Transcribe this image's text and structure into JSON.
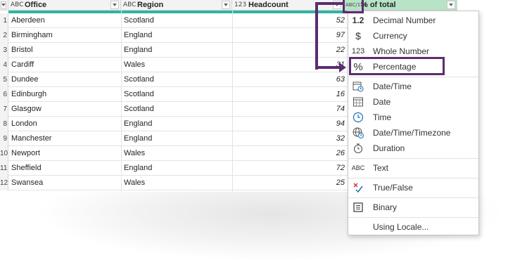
{
  "columns": [
    {
      "type_icon": "ABC",
      "name": "Office"
    },
    {
      "type_icon": "ABC",
      "name": "Region"
    },
    {
      "type_icon": "123",
      "name": "Headcount"
    },
    {
      "type_icon": "ABC/123",
      "name": "% of total"
    }
  ],
  "rows": [
    {
      "idx": "1",
      "office": "Aberdeen",
      "region": "Scotland",
      "headcount": "52"
    },
    {
      "idx": "2",
      "office": "Birmingham",
      "region": "England",
      "headcount": "97"
    },
    {
      "idx": "3",
      "office": "Bristol",
      "region": "England",
      "headcount": "22"
    },
    {
      "idx": "4",
      "office": "Cardiff",
      "region": "Wales",
      "headcount": "31"
    },
    {
      "idx": "5",
      "office": "Dundee",
      "region": "Scotland",
      "headcount": "63"
    },
    {
      "idx": "6",
      "office": "Edinburgh",
      "region": "Scotland",
      "headcount": "16"
    },
    {
      "idx": "7",
      "office": "Glasgow",
      "region": "Scotland",
      "headcount": "74"
    },
    {
      "idx": "8",
      "office": "London",
      "region": "England",
      "headcount": "94"
    },
    {
      "idx": "9",
      "office": "Manchester",
      "region": "England",
      "headcount": "32"
    },
    {
      "idx": "10",
      "office": "Newport",
      "region": "Wales",
      "headcount": "26"
    },
    {
      "idx": "11",
      "office": "Sheffield",
      "region": "England",
      "headcount": "72"
    },
    {
      "idx": "12",
      "office": "Swansea",
      "region": "Wales",
      "headcount": "25"
    }
  ],
  "menu": {
    "items": [
      {
        "icon": "1.2",
        "label": "Decimal Number"
      },
      {
        "icon": "$",
        "label": "Currency"
      },
      {
        "icon": "123",
        "label": "Whole Number"
      },
      {
        "icon": "%",
        "label": "Percentage"
      },
      {
        "icon": "calendar-clock-icon",
        "label": "Date/Time"
      },
      {
        "icon": "calendar-icon",
        "label": "Date"
      },
      {
        "icon": "clock-icon",
        "label": "Time"
      },
      {
        "icon": "globe-clock-icon",
        "label": "Date/Time/Timezone"
      },
      {
        "icon": "stopwatch-icon",
        "label": "Duration"
      },
      {
        "icon": "ABC",
        "label": "Text"
      },
      {
        "icon": "x-check-icon",
        "label": "True/False"
      },
      {
        "icon": "binary-icon",
        "label": "Binary"
      },
      {
        "icon": "",
        "label": "Using Locale..."
      }
    ]
  },
  "colors": {
    "highlight": "#5b2c6f",
    "selected_header": "#b7e4c7",
    "teal_bar": "#2fb6a4"
  }
}
